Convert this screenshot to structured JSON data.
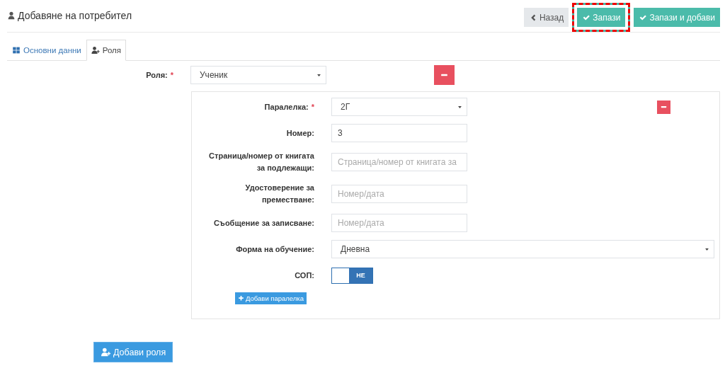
{
  "header": {
    "title": "Добавяне на потребител",
    "buttons": [
      {
        "kind": "back",
        "label": "Назад",
        "highlighted": false
      },
      {
        "kind": "save",
        "label": "Запази",
        "highlighted": true
      },
      {
        "kind": "save",
        "label": "Запази и добави",
        "highlighted": false
      }
    ]
  },
  "tabs": [
    {
      "kind": "grid",
      "label": "Основни данни",
      "selected": false
    },
    {
      "kind": "user",
      "label": "Роля",
      "selected": true
    }
  ],
  "role": {
    "label": "Роля:",
    "required_mark": "*",
    "value": "Ученик"
  },
  "panel": {
    "fields": [
      {
        "kind": "select",
        "label": "Паралелка:",
        "required_mark": "*",
        "value": "2Г"
      },
      {
        "kind": "input",
        "label": "Номер:",
        "value": "3"
      },
      {
        "kind": "input",
        "label": "Страница/номер от книгата за подлежащи:",
        "placeholder": "Страница/номер от книгата за"
      },
      {
        "kind": "input",
        "label": "Удостоверение за преместване:",
        "placeholder": "Номер/дата"
      },
      {
        "kind": "input",
        "label": "Съобщение за записване:",
        "placeholder": "Номер/дата"
      },
      {
        "kind": "wide-select",
        "label": "Форма на обучение:",
        "value": "Дневна"
      },
      {
        "kind": "toggle",
        "label": "СОП:",
        "on": false,
        "text": "НЕ"
      }
    ],
    "add_button": "Добави паралелка"
  },
  "add_role_button": "Добави роля"
}
